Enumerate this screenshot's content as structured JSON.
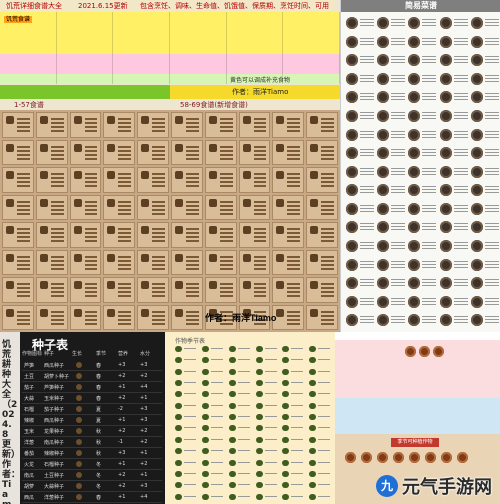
{
  "header": {
    "left_title": "饥荒详细食谱大全",
    "version": "2021.6.15更新",
    "note": "包含烹饪、调味、生命值、饥饿值、保质期、烹饪时间、可用食材",
    "right_note": "黄色可以调成补充食物",
    "section_a": "1-57食谱",
    "section_b": "58-69食谱(新增食谱)",
    "author_badge": "作者：雨洋Tiamo",
    "small_tag": "饥荒食谱"
  },
  "recipe_panel": {
    "author": "作者：雨洋Tiamo"
  },
  "menu_panel": {
    "title": "简易菜谱"
  },
  "seed_panel": {
    "side_text": "饥荒耕种大全（2024.8更新）作者：Tiamo",
    "title": "种子表",
    "columns": [
      "作物图标",
      "种子",
      "生长",
      "季节",
      "营养",
      "水分"
    ],
    "rows": [
      [
        "芦笋",
        "西瓜种子",
        "春",
        "+3",
        "+3"
      ],
      [
        "土豆",
        "胡萝卜种子",
        "春",
        "+2",
        "+2"
      ],
      [
        "茄子",
        "芦笋种子",
        "春",
        "+1",
        "+4"
      ],
      [
        "大蒜",
        "玉米种子",
        "春",
        "+2",
        "+1"
      ],
      [
        "石榴",
        "茄子种子",
        "夏",
        "-2",
        "+3"
      ],
      [
        "辣椒",
        "西瓜种子",
        "夏",
        "+1",
        "+3"
      ],
      [
        "玉米",
        "龙果种子",
        "秋",
        "+2",
        "+2"
      ],
      [
        "洋葱",
        "南瓜种子",
        "秋",
        "-1",
        "+2"
      ],
      [
        "番茄",
        "辣椒种子",
        "秋",
        "+3",
        "+1"
      ],
      [
        "火龙",
        "石榴种子",
        "冬",
        "+1",
        "+2"
      ],
      [
        "南瓜",
        "土豆种子",
        "冬",
        "+2",
        "+1"
      ],
      [
        "胡萝",
        "大蒜种子",
        "冬",
        "+2",
        "+3"
      ],
      [
        "西瓜",
        "洋葱种子",
        "春",
        "+1",
        "+4"
      ],
      [
        "石榴",
        "番茄种子",
        "夏",
        "+3",
        "+2"
      ]
    ]
  },
  "crop_panel": {
    "title": "作物季节表"
  },
  "season_panel": {
    "badge": "季节可种植作物"
  },
  "logo": {
    "mark": "九",
    "text": "元气手游网"
  }
}
